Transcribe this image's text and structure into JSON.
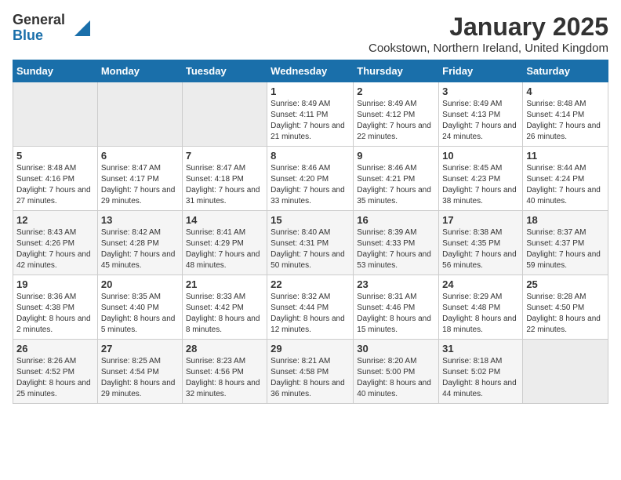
{
  "header": {
    "logo_general": "General",
    "logo_blue": "Blue",
    "month_title": "January 2025",
    "location": "Cookstown, Northern Ireland, United Kingdom"
  },
  "days_of_week": [
    "Sunday",
    "Monday",
    "Tuesday",
    "Wednesday",
    "Thursday",
    "Friday",
    "Saturday"
  ],
  "weeks": [
    [
      {
        "day": "",
        "empty": true
      },
      {
        "day": "",
        "empty": true
      },
      {
        "day": "",
        "empty": true
      },
      {
        "day": "1",
        "sunrise": "Sunrise: 8:49 AM",
        "sunset": "Sunset: 4:11 PM",
        "daylight": "Daylight: 7 hours and 21 minutes."
      },
      {
        "day": "2",
        "sunrise": "Sunrise: 8:49 AM",
        "sunset": "Sunset: 4:12 PM",
        "daylight": "Daylight: 7 hours and 22 minutes."
      },
      {
        "day": "3",
        "sunrise": "Sunrise: 8:49 AM",
        "sunset": "Sunset: 4:13 PM",
        "daylight": "Daylight: 7 hours and 24 minutes."
      },
      {
        "day": "4",
        "sunrise": "Sunrise: 8:48 AM",
        "sunset": "Sunset: 4:14 PM",
        "daylight": "Daylight: 7 hours and 26 minutes."
      }
    ],
    [
      {
        "day": "5",
        "sunrise": "Sunrise: 8:48 AM",
        "sunset": "Sunset: 4:16 PM",
        "daylight": "Daylight: 7 hours and 27 minutes."
      },
      {
        "day": "6",
        "sunrise": "Sunrise: 8:47 AM",
        "sunset": "Sunset: 4:17 PM",
        "daylight": "Daylight: 7 hours and 29 minutes."
      },
      {
        "day": "7",
        "sunrise": "Sunrise: 8:47 AM",
        "sunset": "Sunset: 4:18 PM",
        "daylight": "Daylight: 7 hours and 31 minutes."
      },
      {
        "day": "8",
        "sunrise": "Sunrise: 8:46 AM",
        "sunset": "Sunset: 4:20 PM",
        "daylight": "Daylight: 7 hours and 33 minutes."
      },
      {
        "day": "9",
        "sunrise": "Sunrise: 8:46 AM",
        "sunset": "Sunset: 4:21 PM",
        "daylight": "Daylight: 7 hours and 35 minutes."
      },
      {
        "day": "10",
        "sunrise": "Sunrise: 8:45 AM",
        "sunset": "Sunset: 4:23 PM",
        "daylight": "Daylight: 7 hours and 38 minutes."
      },
      {
        "day": "11",
        "sunrise": "Sunrise: 8:44 AM",
        "sunset": "Sunset: 4:24 PM",
        "daylight": "Daylight: 7 hours and 40 minutes."
      }
    ],
    [
      {
        "day": "12",
        "sunrise": "Sunrise: 8:43 AM",
        "sunset": "Sunset: 4:26 PM",
        "daylight": "Daylight: 7 hours and 42 minutes."
      },
      {
        "day": "13",
        "sunrise": "Sunrise: 8:42 AM",
        "sunset": "Sunset: 4:28 PM",
        "daylight": "Daylight: 7 hours and 45 minutes."
      },
      {
        "day": "14",
        "sunrise": "Sunrise: 8:41 AM",
        "sunset": "Sunset: 4:29 PM",
        "daylight": "Daylight: 7 hours and 48 minutes."
      },
      {
        "day": "15",
        "sunrise": "Sunrise: 8:40 AM",
        "sunset": "Sunset: 4:31 PM",
        "daylight": "Daylight: 7 hours and 50 minutes."
      },
      {
        "day": "16",
        "sunrise": "Sunrise: 8:39 AM",
        "sunset": "Sunset: 4:33 PM",
        "daylight": "Daylight: 7 hours and 53 minutes."
      },
      {
        "day": "17",
        "sunrise": "Sunrise: 8:38 AM",
        "sunset": "Sunset: 4:35 PM",
        "daylight": "Daylight: 7 hours and 56 minutes."
      },
      {
        "day": "18",
        "sunrise": "Sunrise: 8:37 AM",
        "sunset": "Sunset: 4:37 PM",
        "daylight": "Daylight: 7 hours and 59 minutes."
      }
    ],
    [
      {
        "day": "19",
        "sunrise": "Sunrise: 8:36 AM",
        "sunset": "Sunset: 4:38 PM",
        "daylight": "Daylight: 8 hours and 2 minutes."
      },
      {
        "day": "20",
        "sunrise": "Sunrise: 8:35 AM",
        "sunset": "Sunset: 4:40 PM",
        "daylight": "Daylight: 8 hours and 5 minutes."
      },
      {
        "day": "21",
        "sunrise": "Sunrise: 8:33 AM",
        "sunset": "Sunset: 4:42 PM",
        "daylight": "Daylight: 8 hours and 8 minutes."
      },
      {
        "day": "22",
        "sunrise": "Sunrise: 8:32 AM",
        "sunset": "Sunset: 4:44 PM",
        "daylight": "Daylight: 8 hours and 12 minutes."
      },
      {
        "day": "23",
        "sunrise": "Sunrise: 8:31 AM",
        "sunset": "Sunset: 4:46 PM",
        "daylight": "Daylight: 8 hours and 15 minutes."
      },
      {
        "day": "24",
        "sunrise": "Sunrise: 8:29 AM",
        "sunset": "Sunset: 4:48 PM",
        "daylight": "Daylight: 8 hours and 18 minutes."
      },
      {
        "day": "25",
        "sunrise": "Sunrise: 8:28 AM",
        "sunset": "Sunset: 4:50 PM",
        "daylight": "Daylight: 8 hours and 22 minutes."
      }
    ],
    [
      {
        "day": "26",
        "sunrise": "Sunrise: 8:26 AM",
        "sunset": "Sunset: 4:52 PM",
        "daylight": "Daylight: 8 hours and 25 minutes."
      },
      {
        "day": "27",
        "sunrise": "Sunrise: 8:25 AM",
        "sunset": "Sunset: 4:54 PM",
        "daylight": "Daylight: 8 hours and 29 minutes."
      },
      {
        "day": "28",
        "sunrise": "Sunrise: 8:23 AM",
        "sunset": "Sunset: 4:56 PM",
        "daylight": "Daylight: 8 hours and 32 minutes."
      },
      {
        "day": "29",
        "sunrise": "Sunrise: 8:21 AM",
        "sunset": "Sunset: 4:58 PM",
        "daylight": "Daylight: 8 hours and 36 minutes."
      },
      {
        "day": "30",
        "sunrise": "Sunrise: 8:20 AM",
        "sunset": "Sunset: 5:00 PM",
        "daylight": "Daylight: 8 hours and 40 minutes."
      },
      {
        "day": "31",
        "sunrise": "Sunrise: 8:18 AM",
        "sunset": "Sunset: 5:02 PM",
        "daylight": "Daylight: 8 hours and 44 minutes."
      },
      {
        "day": "",
        "empty": true
      }
    ]
  ]
}
